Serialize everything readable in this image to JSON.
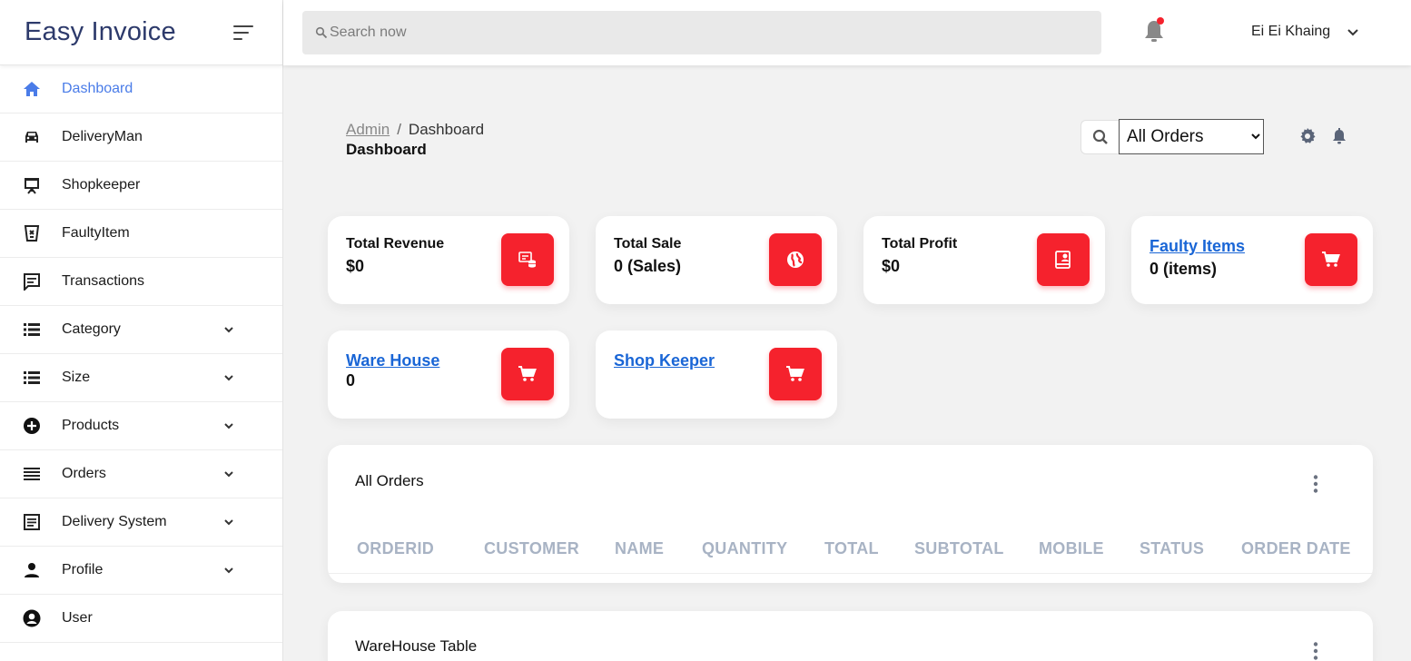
{
  "sidebar": {
    "brand": "Easy Invoice",
    "items": [
      {
        "label": "Dashboard",
        "icon": "home-icon",
        "active": true,
        "expandable": false
      },
      {
        "label": "DeliveryMan",
        "icon": "car-icon",
        "active": false,
        "expandable": false
      },
      {
        "label": "Shopkeeper",
        "icon": "presentation-icon",
        "active": false,
        "expandable": false
      },
      {
        "label": "FaultyItem",
        "icon": "faulty-bin-icon",
        "active": false,
        "expandable": false
      },
      {
        "label": "Transactions",
        "icon": "message-icon",
        "active": false,
        "expandable": false
      },
      {
        "label": "Category",
        "icon": "list-icon",
        "active": false,
        "expandable": true
      },
      {
        "label": "Size",
        "icon": "list-icon",
        "active": false,
        "expandable": true
      },
      {
        "label": "Products",
        "icon": "plus-circle-icon",
        "active": false,
        "expandable": true
      },
      {
        "label": "Orders",
        "icon": "lines-icon",
        "active": false,
        "expandable": true
      },
      {
        "label": "Delivery System",
        "icon": "document-icon",
        "active": false,
        "expandable": true
      },
      {
        "label": "Profile",
        "icon": "person-icon",
        "active": false,
        "expandable": true
      },
      {
        "label": "User",
        "icon": "account-circle-icon",
        "active": false,
        "expandable": false
      }
    ]
  },
  "topbar": {
    "search_placeholder": "Search now",
    "user_name": "Ei Ei Khaing"
  },
  "breadcrumb": {
    "root": "Admin",
    "separator": "/",
    "current": "Dashboard"
  },
  "page_title": "Dashboard",
  "filter": {
    "selected": "All Orders",
    "options": [
      "All Orders"
    ]
  },
  "stats": [
    {
      "title": "Total Revenue",
      "value": "$0",
      "icon": "revenue-icon",
      "link": false
    },
    {
      "title": "Total Sale",
      "value": "0 (Sales)",
      "icon": "globe-icon",
      "link": false
    },
    {
      "title": "Total Profit",
      "value": "$0",
      "icon": "profit-icon",
      "link": false
    },
    {
      "title": "Faulty Items",
      "value": "0 (items)",
      "icon": "cart-icon",
      "link": true
    },
    {
      "title": "Ware House",
      "value": "0",
      "icon": "cart-icon",
      "link": true
    },
    {
      "title": "Shop Keeper",
      "value": "",
      "icon": "cart-icon",
      "link": true
    }
  ],
  "orders_table": {
    "title": "All Orders",
    "columns": [
      "ORDERID",
      "CUSTOMER",
      "NAME",
      "QUANTITY",
      "TOTAL",
      "SUBTOTAL",
      "MOBILE",
      "STATUS",
      "ORDER DATE"
    ]
  },
  "warehouse_table": {
    "title": "WareHouse Table"
  },
  "colors": {
    "accent_blue": "#4a7ce8",
    "badge_red": "#f5222d",
    "link_blue": "#1a66d6",
    "brand_navy": "#2d3a6b",
    "notification_dot": "#f5222d"
  }
}
